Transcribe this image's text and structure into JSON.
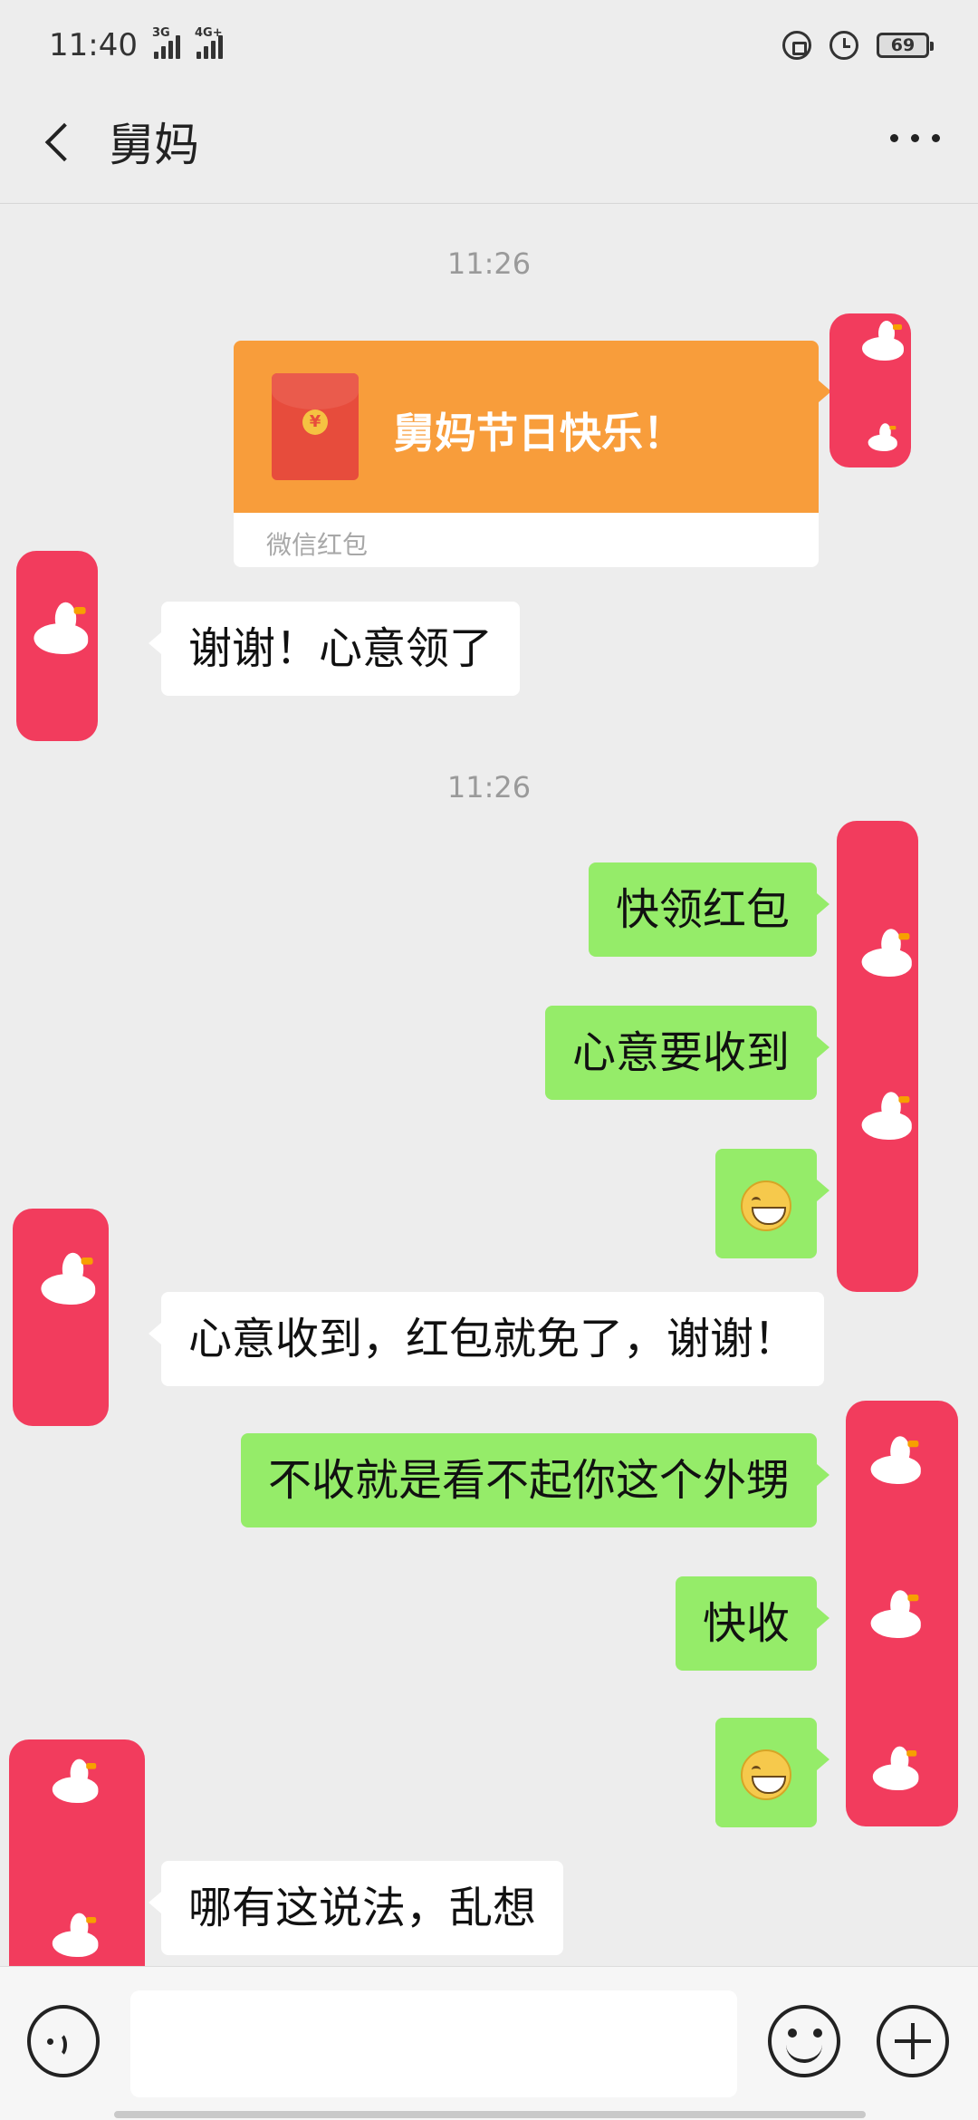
{
  "status_bar": {
    "time": "11:40",
    "network_1": "3G",
    "network_2": "4G+",
    "battery": "69"
  },
  "header": {
    "title": "舅妈",
    "back_icon": "chevron-left-icon",
    "more_icon": "ellipsis-icon"
  },
  "colors": {
    "background": "#ededed",
    "my_bubble": "#95ec69",
    "their_bubble": "#ffffff",
    "red_packet": "#f89d3b",
    "avatar": "#f23c5d"
  },
  "messages": {
    "timestamp_1": "11:26",
    "red_packet": {
      "text": "舅妈节日快乐！",
      "label": "微信红包",
      "coin": "¥"
    },
    "reply_1": "谢谢！心意领了",
    "timestamp_2": "11:26",
    "msg_1": "快领红包",
    "msg_2": "心意要收到",
    "msg_3_emoji": "grin-emoji",
    "reply_2": "心意收到，红包就免了，谢谢！",
    "msg_4": "不收就是看不起你这个外甥",
    "msg_5": "快收",
    "msg_6_emoji": "grin-emoji",
    "reply_3": "哪有这说法，乱想"
  },
  "input_bar": {
    "voice_icon": "voice-icon",
    "input_value": "",
    "emoji_icon": "emoji-icon",
    "plus_icon": "plus-icon"
  }
}
